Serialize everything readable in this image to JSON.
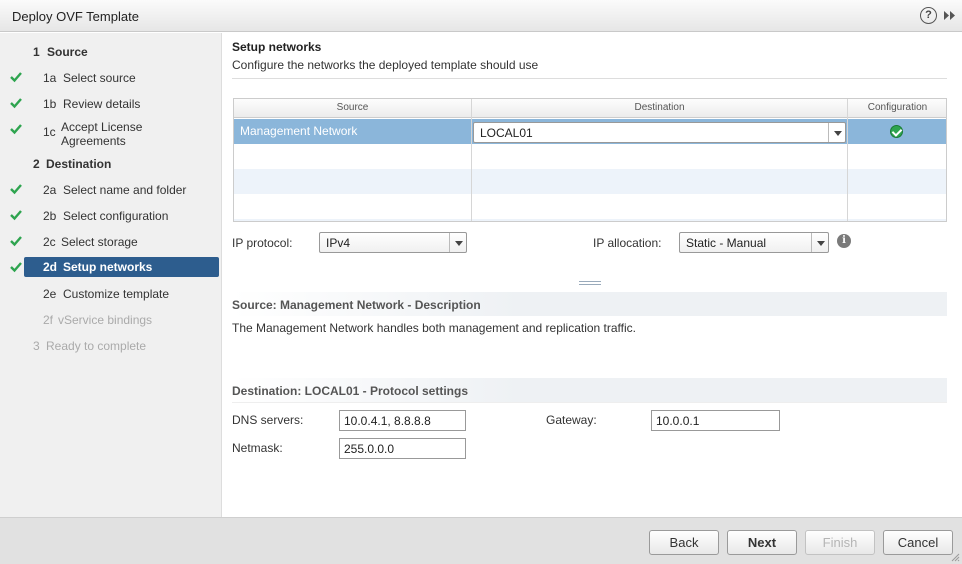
{
  "window": {
    "title": "Deploy OVF Template"
  },
  "icons": {
    "help": "help-icon",
    "expand": "expand-icon",
    "check": "check-icon",
    "info": "info-icon"
  },
  "colors": {
    "accent": "#2d5d8e",
    "selected_row": "#8bb6da",
    "check": "#2ea44f"
  },
  "nav": {
    "items": [
      {
        "num": "1",
        "label": "Source",
        "type": "section",
        "checked": false
      },
      {
        "num": "1a",
        "label": "Select source",
        "type": "step",
        "checked": true
      },
      {
        "num": "1b",
        "label": "Review details",
        "type": "step",
        "checked": true
      },
      {
        "num": "1c",
        "label": "Accept License Agreements",
        "type": "step",
        "checked": true
      },
      {
        "num": "2",
        "label": "Destination",
        "type": "section",
        "checked": false
      },
      {
        "num": "2a",
        "label": "Select name and folder",
        "type": "step",
        "checked": true
      },
      {
        "num": "2b",
        "label": "Select configuration",
        "type": "step",
        "checked": true
      },
      {
        "num": "2c",
        "label": "Select storage",
        "type": "step",
        "checked": true
      },
      {
        "num": "2d",
        "label": "Setup networks",
        "type": "step",
        "checked": true,
        "active": true
      },
      {
        "num": "2e",
        "label": "Customize template",
        "type": "step",
        "checked": false
      },
      {
        "num": "2f",
        "label": "vService bindings",
        "type": "step",
        "checked": false,
        "disabled": true
      },
      {
        "num": "3",
        "label": "Ready to complete",
        "type": "section",
        "checked": false,
        "disabled": true
      }
    ]
  },
  "main": {
    "title": "Setup networks",
    "subtitle": "Configure the networks the deployed template should use",
    "table": {
      "columns": [
        "Source",
        "Destination",
        "Configuration"
      ],
      "rows": [
        {
          "source": "Management Network",
          "destination": "LOCAL01",
          "configuration": "ok"
        }
      ]
    },
    "ip_protocol": {
      "label": "IP protocol:",
      "value": "IPv4"
    },
    "ip_allocation": {
      "label": "IP allocation:",
      "value": "Static - Manual"
    },
    "source_desc": {
      "title": "Source: Management Network - Description",
      "text": "The Management Network handles both management and replication traffic."
    },
    "dest_settings": {
      "title": "Destination: LOCAL01 - Protocol settings",
      "dns_label": "DNS servers:",
      "dns_value": "10.0.4.1, 8.8.8.8",
      "gateway_label": "Gateway:",
      "gateway_value": "10.0.0.1",
      "netmask_label": "Netmask:",
      "netmask_value": "255.0.0.0"
    }
  },
  "footer": {
    "back": "Back",
    "next": "Next",
    "finish": "Finish",
    "cancel": "Cancel"
  }
}
